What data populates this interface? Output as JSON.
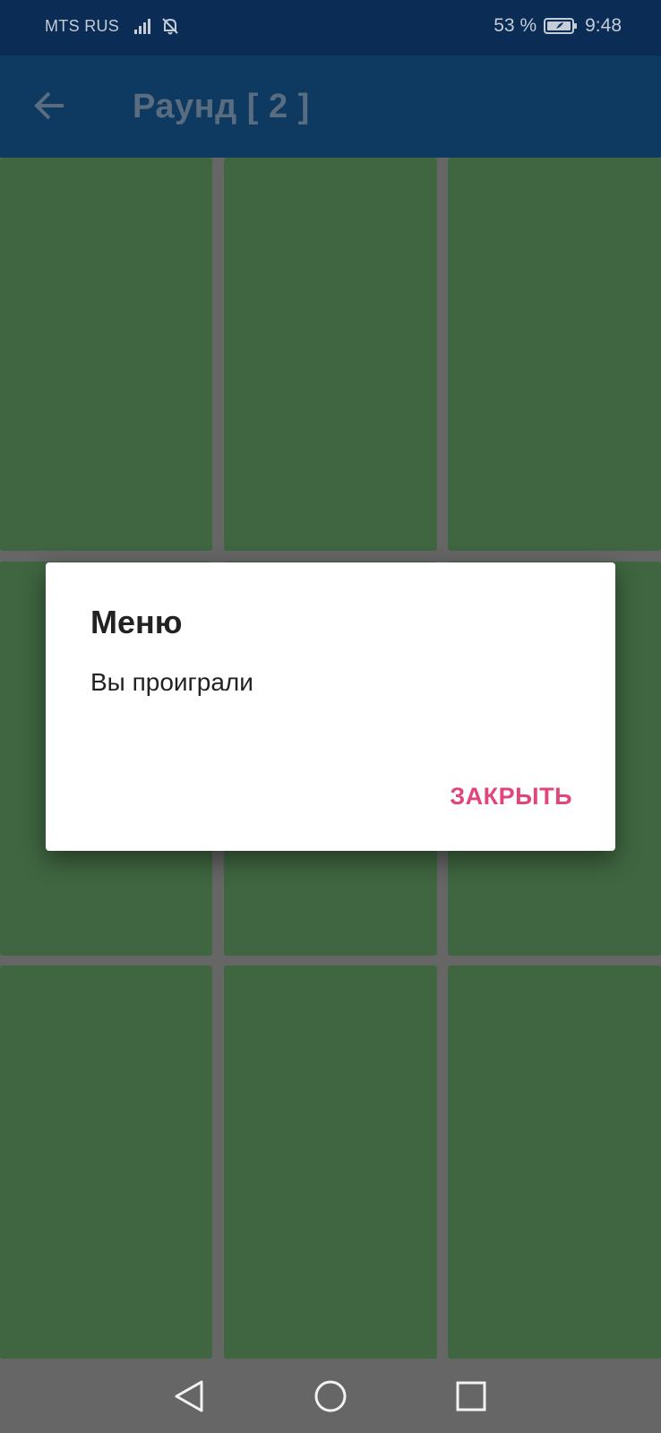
{
  "status_bar": {
    "carrier": "MTS RUS",
    "battery_percent": "53 %",
    "time": "9:48",
    "icons": [
      "signal-icon",
      "bell-off-icon",
      "battery-icon"
    ]
  },
  "app_bar": {
    "title": "Раунд [ 2 ]",
    "back_icon": "arrow-left-icon"
  },
  "grid": {
    "rows": 3,
    "columns": 3,
    "tile_color": "#3f6640"
  },
  "dialog": {
    "title": "Меню",
    "message": "Вы проиграли",
    "button_label": "ЗАКРЫТЬ",
    "button_color": "#e0457c"
  },
  "nav_bar": {
    "icons": [
      "nav-back-icon",
      "nav-home-icon",
      "nav-recent-icon"
    ]
  },
  "colors": {
    "status_bar_bg": "#0b2c55",
    "app_bar_bg": "#0e3a61",
    "grid_gap": "#666666"
  }
}
